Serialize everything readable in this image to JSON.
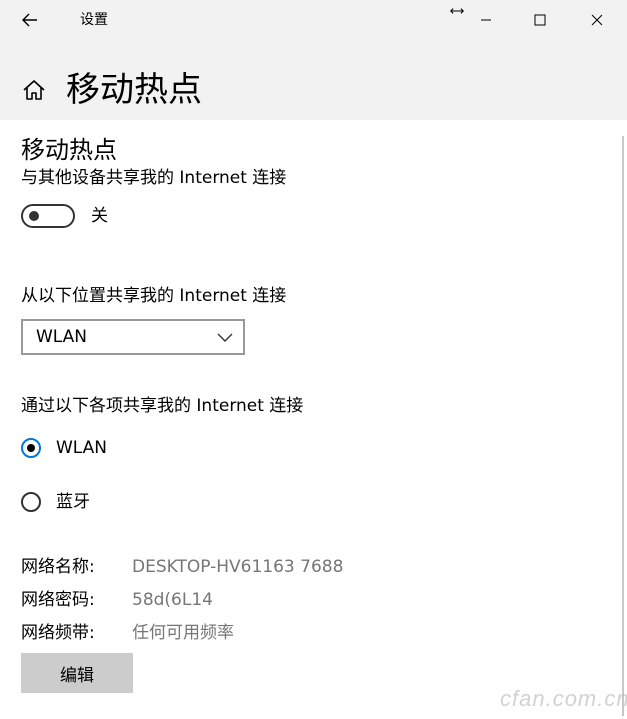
{
  "window": {
    "title": "设置"
  },
  "header": {
    "title": "移动热点"
  },
  "hotspot": {
    "section_title": "移动热点",
    "share_label": "与其他设备共享我的 Internet 连接",
    "toggle_state": "关",
    "toggle_on": false
  },
  "share_from": {
    "label": "从以下位置共享我的 Internet 连接",
    "selected": "WLAN"
  },
  "share_over": {
    "label": "通过以下各项共享我的 Internet 连接",
    "options": [
      {
        "label": "WLAN",
        "checked": true
      },
      {
        "label": "蓝牙",
        "checked": false
      }
    ]
  },
  "network": {
    "name_label": "网络名称:",
    "name_value": "DESKTOP-HV61163 7688",
    "password_label": "网络密码:",
    "password_value": "58d(6L14",
    "band_label": "网络频带:",
    "band_value": "任何可用频率"
  },
  "edit_button": {
    "label": "编辑"
  },
  "watermark": "cfan.com.cn",
  "colors": {
    "accent": "#0078d7",
    "header_bg": "#f2f2f2",
    "button_bg": "#cccccc",
    "secondary_text": "#767676"
  },
  "icons": {
    "back": "back-arrow-icon",
    "home": "home-icon",
    "minimize": "minimize-icon",
    "maximize": "maximize-icon",
    "close": "close-icon",
    "dropdown": "chevron-down-icon"
  }
}
